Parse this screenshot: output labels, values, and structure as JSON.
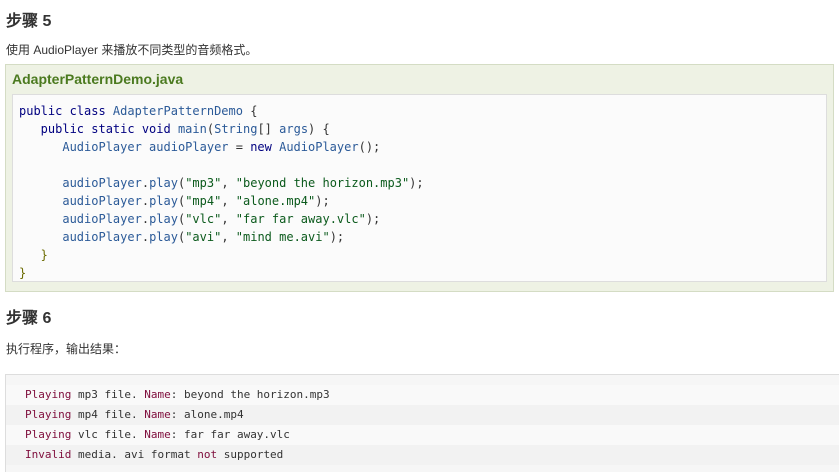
{
  "step5": {
    "heading": "步骤 5",
    "description": "使用 AudioPlayer 来播放不同类型的音频格式。",
    "file_title": "AdapterPatternDemo.java",
    "code_lines": [
      [
        [
          "kw",
          "public class "
        ],
        [
          "typ",
          "AdapterPatternDemo "
        ],
        [
          "pun",
          "{"
        ]
      ],
      [
        [
          "kw",
          "   public static void "
        ],
        [
          "plain",
          "main"
        ],
        [
          "pun",
          "("
        ],
        [
          "typ",
          "String"
        ],
        [
          "pun",
          "[] "
        ],
        [
          "plain",
          "args"
        ],
        [
          "pun",
          ") {"
        ]
      ],
      [
        [
          "typ",
          "      AudioPlayer "
        ],
        [
          "plain",
          "audioPlayer "
        ],
        [
          "pun",
          "= "
        ],
        [
          "kw",
          "new "
        ],
        [
          "typ",
          "AudioPlayer"
        ],
        [
          "pun",
          "();"
        ]
      ],
      [
        [
          "pun",
          ""
        ]
      ],
      [
        [
          "plain",
          "      audioPlayer"
        ],
        [
          "pun",
          "."
        ],
        [
          "plain",
          "play"
        ],
        [
          "pun",
          "("
        ],
        [
          "str",
          "\"mp3\""
        ],
        [
          "pun",
          ", "
        ],
        [
          "str",
          "\"beyond the horizon.mp3\""
        ],
        [
          "pun",
          ");"
        ]
      ],
      [
        [
          "plain",
          "      audioPlayer"
        ],
        [
          "pun",
          "."
        ],
        [
          "plain",
          "play"
        ],
        [
          "pun",
          "("
        ],
        [
          "str",
          "\"mp4\""
        ],
        [
          "pun",
          ", "
        ],
        [
          "str",
          "\"alone.mp4\""
        ],
        [
          "pun",
          ");"
        ]
      ],
      [
        [
          "plain",
          "      audioPlayer"
        ],
        [
          "pun",
          "."
        ],
        [
          "plain",
          "play"
        ],
        [
          "pun",
          "("
        ],
        [
          "str",
          "\"vlc\""
        ],
        [
          "pun",
          ", "
        ],
        [
          "str",
          "\"far far away.vlc\""
        ],
        [
          "pun",
          ");"
        ]
      ],
      [
        [
          "plain",
          "      audioPlayer"
        ],
        [
          "pun",
          "."
        ],
        [
          "plain",
          "play"
        ],
        [
          "pun",
          "("
        ],
        [
          "str",
          "\"avi\""
        ],
        [
          "pun",
          ", "
        ],
        [
          "str",
          "\"mind me.avi\""
        ],
        [
          "pun",
          ");"
        ]
      ],
      [
        [
          "brace",
          "   }"
        ]
      ],
      [
        [
          "brace",
          "}"
        ]
      ]
    ]
  },
  "step6": {
    "heading": "步骤 6",
    "description": "执行程序，输出结果：",
    "output_lines": [
      [
        [
          "o-kw",
          "Playing "
        ],
        [
          "o-plain",
          "mp3 file. "
        ],
        [
          "o-kw",
          "Name"
        ],
        [
          "o-plain",
          ": beyond the horizon.mp3"
        ]
      ],
      [
        [
          "o-kw",
          "Playing "
        ],
        [
          "o-plain",
          "mp4 file. "
        ],
        [
          "o-kw",
          "Name"
        ],
        [
          "o-plain",
          ": alone.mp4"
        ]
      ],
      [
        [
          "o-kw",
          "Playing "
        ],
        [
          "o-plain",
          "vlc file. "
        ],
        [
          "o-kw",
          "Name"
        ],
        [
          "o-plain",
          ": far far away.vlc"
        ]
      ],
      [
        [
          "o-kw",
          "Invalid "
        ],
        [
          "o-plain",
          "media. avi format "
        ],
        [
          "o-kw",
          "not "
        ],
        [
          "o-plain",
          "supported"
        ]
      ]
    ]
  }
}
